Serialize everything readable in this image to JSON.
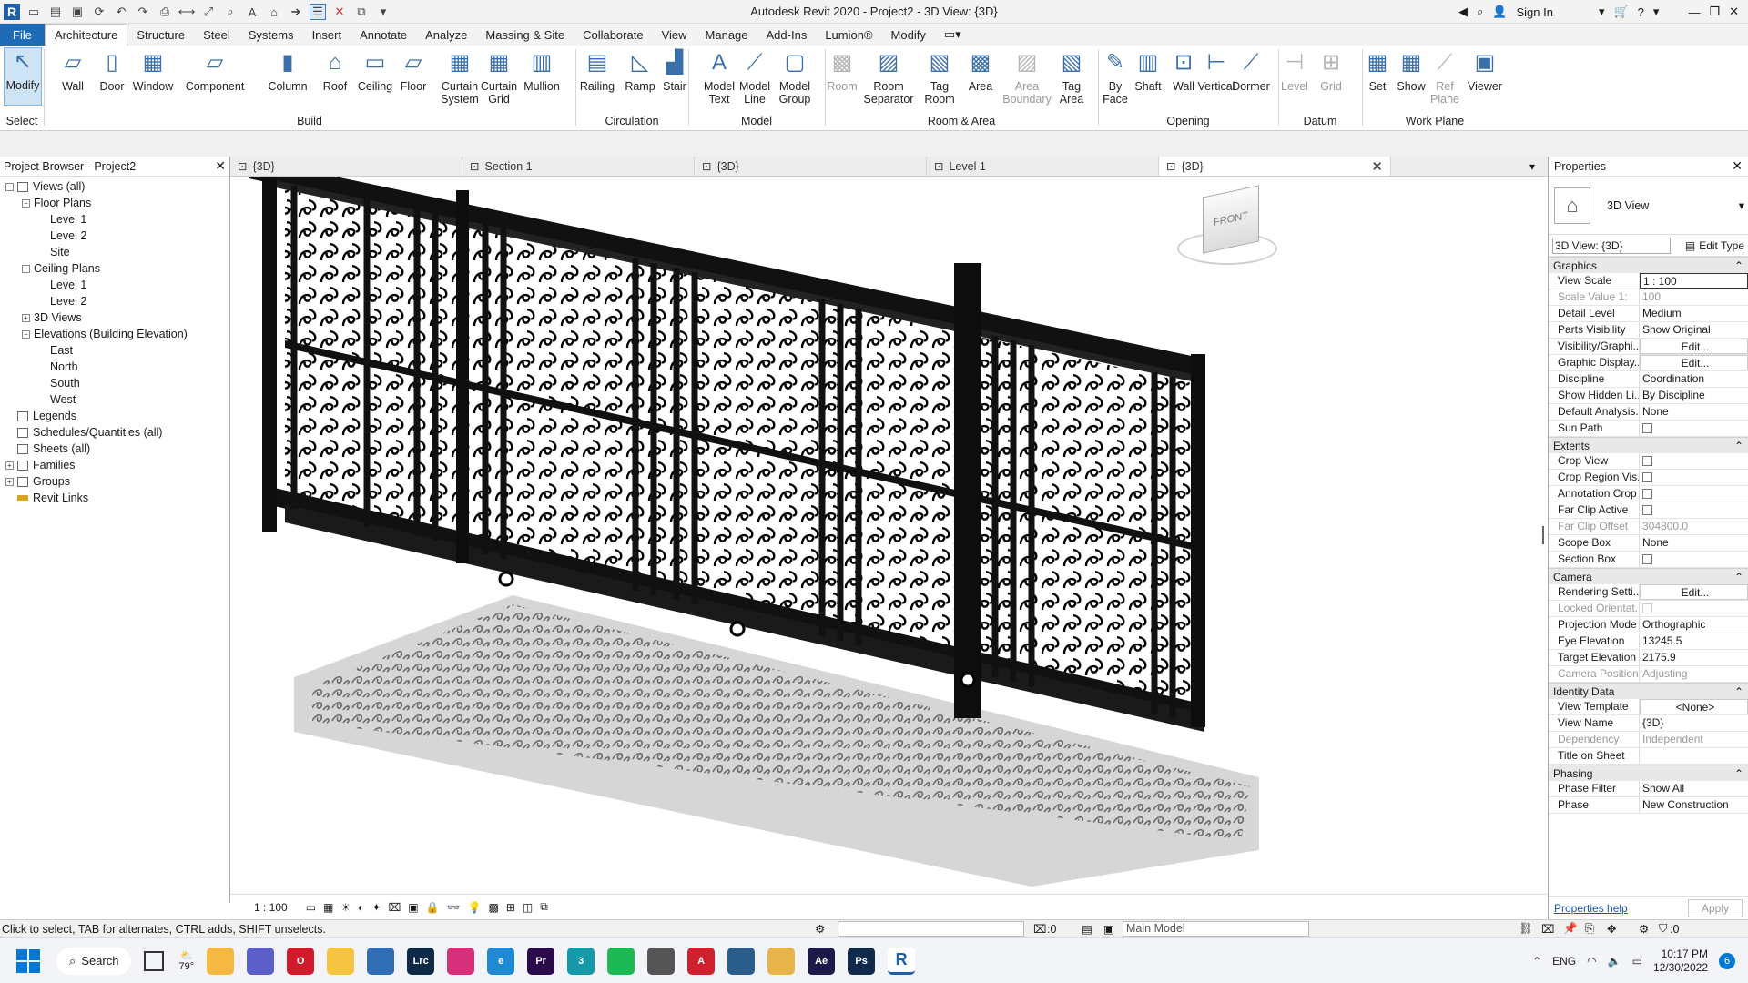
{
  "titlebar": {
    "title": "Autodesk Revit 2020 - Project2 - 3D View: {3D}",
    "sign_in": "Sign In"
  },
  "tabs": [
    "File",
    "Architecture",
    "Structure",
    "Steel",
    "Systems",
    "Insert",
    "Annotate",
    "Analyze",
    "Massing & Site",
    "Collaborate",
    "View",
    "Manage",
    "Add-Ins",
    "Lumion®",
    "Modify"
  ],
  "active_tab": "Architecture",
  "ribbon": {
    "buttons": [
      {
        "label": "Modify",
        "name": "modify"
      },
      {
        "label": "Wall",
        "name": "wall"
      },
      {
        "label": "Door",
        "name": "door"
      },
      {
        "label": "Window",
        "name": "window"
      },
      {
        "label": "Component",
        "name": "component"
      },
      {
        "label": "Column",
        "name": "column"
      },
      {
        "label": "Roof",
        "name": "roof"
      },
      {
        "label": "Ceiling",
        "name": "ceiling"
      },
      {
        "label": "Floor",
        "name": "floor"
      },
      {
        "label": "Curtain System",
        "name": "curtain-system"
      },
      {
        "label": "Curtain Grid",
        "name": "curtain-grid"
      },
      {
        "label": "Mullion",
        "name": "mullion"
      },
      {
        "label": "Railing",
        "name": "railing"
      },
      {
        "label": "Ramp",
        "name": "ramp"
      },
      {
        "label": "Stair",
        "name": "stair"
      },
      {
        "label": "Model Text",
        "name": "model-text"
      },
      {
        "label": "Model Line",
        "name": "model-line"
      },
      {
        "label": "Model Group",
        "name": "model-group"
      },
      {
        "label": "Room",
        "name": "room"
      },
      {
        "label": "Room Separator",
        "name": "room-separator"
      },
      {
        "label": "Tag Room",
        "name": "tag-room"
      },
      {
        "label": "Area",
        "name": "area"
      },
      {
        "label": "Area Boundary",
        "name": "area-boundary"
      },
      {
        "label": "Tag Area",
        "name": "tag-area"
      },
      {
        "label": "By Face",
        "name": "by-face"
      },
      {
        "label": "Shaft",
        "name": "shaft"
      },
      {
        "label": "Wall",
        "name": "opening-wall"
      },
      {
        "label": "Vertical",
        "name": "vertical"
      },
      {
        "label": "Dormer",
        "name": "dormer"
      },
      {
        "label": "Level",
        "name": "level"
      },
      {
        "label": "Grid",
        "name": "grid"
      },
      {
        "label": "Set",
        "name": "set"
      },
      {
        "label": "Show",
        "name": "show"
      },
      {
        "label": "Ref Plane",
        "name": "ref-plane"
      },
      {
        "label": "Viewer",
        "name": "viewer"
      }
    ],
    "groups": [
      "Select",
      "Build",
      "Circulation",
      "Model",
      "Room & Area",
      "Opening",
      "Datum",
      "Work Plane"
    ]
  },
  "project_browser": {
    "title": "Project Browser - Project2",
    "nodes": [
      {
        "label": "Views (all)",
        "level": 0,
        "toggle": "−",
        "icon": "views"
      },
      {
        "label": "Floor Plans",
        "level": 1,
        "toggle": "−"
      },
      {
        "label": "Level 1",
        "level": 2
      },
      {
        "label": "Level 2",
        "level": 2
      },
      {
        "label": "Site",
        "level": 2
      },
      {
        "label": "Ceiling Plans",
        "level": 1,
        "toggle": "−"
      },
      {
        "label": "Level 1",
        "level": 2
      },
      {
        "label": "Level 2",
        "level": 2
      },
      {
        "label": "3D Views",
        "level": 1,
        "toggle": "+"
      },
      {
        "label": "Elevations (Building Elevation)",
        "level": 1,
        "toggle": "−"
      },
      {
        "label": "East",
        "level": 2
      },
      {
        "label": "North",
        "level": 2
      },
      {
        "label": "South",
        "level": 2
      },
      {
        "label": "West",
        "level": 2
      },
      {
        "label": "Legends",
        "level": 0,
        "icon": "legend"
      },
      {
        "label": "Schedules/Quantities (all)",
        "level": 0,
        "icon": "schedule"
      },
      {
        "label": "Sheets (all)",
        "level": 0,
        "icon": "sheet"
      },
      {
        "label": "Families",
        "level": 0,
        "toggle": "+",
        "icon": "family"
      },
      {
        "label": "Groups",
        "level": 0,
        "toggle": "+",
        "icon": "group"
      },
      {
        "label": "Revit Links",
        "level": 0,
        "icon": "link"
      }
    ]
  },
  "view_tabs": [
    {
      "label": "{3D}",
      "active": false
    },
    {
      "label": "Section 1",
      "active": false
    },
    {
      "label": "{3D}",
      "active": false
    },
    {
      "label": "Level 1",
      "active": false
    },
    {
      "label": "{3D}",
      "active": true
    }
  ],
  "view_cube_label": "FRONT",
  "view_bar": {
    "scale": "1 : 100"
  },
  "properties": {
    "title": "Properties",
    "type_name": "3D View",
    "instance_selector": "3D View: {3D}",
    "edit_type": "Edit Type",
    "groups": [
      {
        "name": "Graphics",
        "rows": [
          {
            "k": "View Scale",
            "v": "1 : 100",
            "kind": "input"
          },
          {
            "k": "Scale Value 1:",
            "v": "100",
            "kind": "gray"
          },
          {
            "k": "Detail Level",
            "v": "Medium"
          },
          {
            "k": "Parts Visibility",
            "v": "Show Original"
          },
          {
            "k": "Visibility/Graphi...",
            "v": "Edit...",
            "kind": "btn"
          },
          {
            "k": "Graphic Display...",
            "v": "Edit...",
            "kind": "btn"
          },
          {
            "k": "Discipline",
            "v": "Coordination"
          },
          {
            "k": "Show Hidden Li...",
            "v": "By Discipline"
          },
          {
            "k": "Default Analysis...",
            "v": "None"
          },
          {
            "k": "Sun Path",
            "v": "",
            "kind": "check"
          }
        ]
      },
      {
        "name": "Extents",
        "rows": [
          {
            "k": "Crop View",
            "v": "",
            "kind": "check"
          },
          {
            "k": "Crop Region Vis...",
            "v": "",
            "kind": "check"
          },
          {
            "k": "Annotation Crop",
            "v": "",
            "kind": "check"
          },
          {
            "k": "Far Clip Active",
            "v": "",
            "kind": "check"
          },
          {
            "k": "Far Clip Offset",
            "v": "304800.0",
            "kind": "gray"
          },
          {
            "k": "Scope Box",
            "v": "None"
          },
          {
            "k": "Section Box",
            "v": "",
            "kind": "check"
          }
        ]
      },
      {
        "name": "Camera",
        "rows": [
          {
            "k": "Rendering Setti...",
            "v": "Edit...",
            "kind": "btn"
          },
          {
            "k": "Locked Orientat...",
            "v": "",
            "kind": "graycheck"
          },
          {
            "k": "Projection Mode",
            "v": "Orthographic"
          },
          {
            "k": "Eye Elevation",
            "v": "13245.5"
          },
          {
            "k": "Target Elevation",
            "v": "2175.9"
          },
          {
            "k": "Camera Position",
            "v": "Adjusting",
            "kind": "gray"
          }
        ]
      },
      {
        "name": "Identity Data",
        "rows": [
          {
            "k": "View Template",
            "v": "<None>",
            "kind": "btn"
          },
          {
            "k": "View Name",
            "v": "{3D}"
          },
          {
            "k": "Dependency",
            "v": "Independent",
            "kind": "gray"
          },
          {
            "k": "Title on Sheet",
            "v": ""
          }
        ]
      },
      {
        "name": "Phasing",
        "rows": [
          {
            "k": "Phase Filter",
            "v": "Show All"
          },
          {
            "k": "Phase",
            "v": "New Construction"
          }
        ]
      }
    ],
    "help": "Properties help",
    "apply": "Apply"
  },
  "status": {
    "hint": "Click to select, TAB for alternates, CTRL adds, SHIFT unselects.",
    "zero": ":0",
    "model": "Main Model",
    "filter": ":0"
  },
  "taskbar": {
    "search": "Search",
    "weather": "79°",
    "lang": "ENG",
    "time": "10:17 PM",
    "date": "12/30/2022",
    "notifications": "6",
    "apps": [
      {
        "name": "file-explorer",
        "label": "",
        "color": "#f4b942"
      },
      {
        "name": "teams",
        "label": "",
        "color": "#5b5fc7"
      },
      {
        "name": "opera",
        "label": "O",
        "color": "#d11b2c"
      },
      {
        "name": "folder",
        "label": "",
        "color": "#f5c542"
      },
      {
        "name": "photos",
        "label": "",
        "color": "#2f6db5"
      },
      {
        "name": "lightroom",
        "label": "Lrc",
        "color": "#0e2a47"
      },
      {
        "name": "instagram",
        "label": "",
        "color": "#d6307a"
      },
      {
        "name": "edge",
        "label": "e",
        "color": "#1f8ad2"
      },
      {
        "name": "premiere",
        "label": "Pr",
        "color": "#2a0a4a"
      },
      {
        "name": "3dsmax",
        "label": "3",
        "color": "#1598a8"
      },
      {
        "name": "spotify",
        "label": "",
        "color": "#1db954"
      },
      {
        "name": "app-grey",
        "label": "",
        "color": "#555"
      },
      {
        "name": "autocad",
        "label": "A",
        "color": "#d0202e"
      },
      {
        "name": "app-blue",
        "label": "",
        "color": "#2a5d8a"
      },
      {
        "name": "app-yellow",
        "label": "",
        "color": "#e8b54a"
      },
      {
        "name": "after-effects",
        "label": "Ae",
        "color": "#1d1a49"
      },
      {
        "name": "photoshop",
        "label": "Ps",
        "color": "#0f2a4a"
      },
      {
        "name": "revit",
        "label": "R",
        "color": "#ffffff"
      }
    ]
  }
}
